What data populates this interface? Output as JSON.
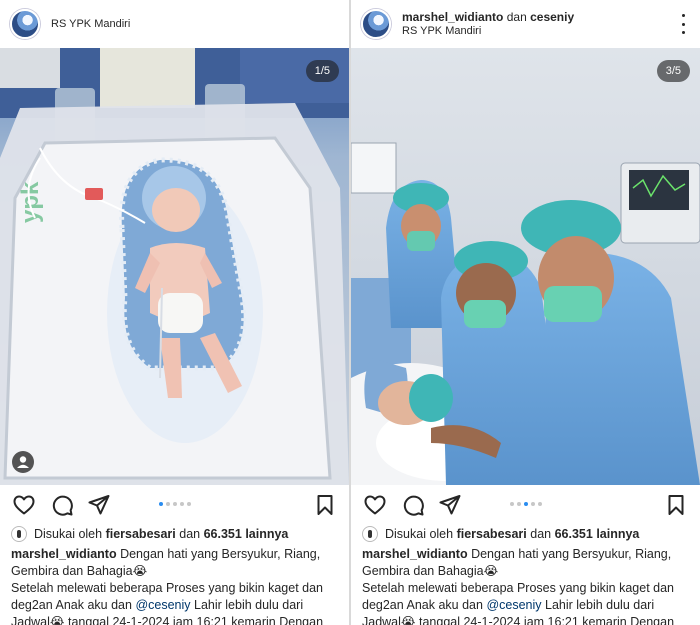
{
  "posts": [
    {
      "header": {
        "username": "",
        "conjunction": "",
        "collaborator": "",
        "location": "RS YPK Mandiri"
      },
      "counter": "1/5",
      "active_dot": 0,
      "likes": {
        "prefix": "Disukai oleh",
        "user": "fiersabesari",
        "middle": "dan",
        "count": "66.351",
        "suffix": "lainnya"
      },
      "caption": {
        "username": "marshel_widianto",
        "line1": "Dengan hati yang Bersyukur, Riang, Gembira dan Bahagia😭",
        "line2_pre": "Setelah melewati beberapa Proses yang bikin kaget dan deg2an Anak aku dan",
        "mention": "@ceseniy",
        "line2_post": "Lahir lebih dulu dari Jadwal😭 tanggal 24-1-2024 jam 16:21 kemarin Dengan"
      }
    },
    {
      "header": {
        "username": "marshel_widianto",
        "conjunction": "dan",
        "collaborator": "ceseniy",
        "location": "RS YPK Mandiri"
      },
      "counter": "3/5",
      "active_dot": 2,
      "likes": {
        "prefix": "Disukai oleh",
        "user": "fiersabesari",
        "middle": "dan",
        "count": "66.351",
        "suffix": "lainnya"
      },
      "caption": {
        "username": "marshel_widianto",
        "line1": "Dengan hati yang Bersyukur, Riang, Gembira dan Bahagia😭",
        "line2_pre": "Setelah melewati beberapa Proses yang bikin kaget dan deg2an Anak aku dan",
        "mention": "@ceseniy",
        "line2_post": "Lahir lebih dulu dari Jadwal😭 tanggal 24-1-2024 jam 16:21 kemarin Dengan"
      }
    }
  ],
  "icons": {
    "like": "heart-icon",
    "comment": "comment-icon",
    "share": "paper-plane-icon",
    "save": "bookmark-icon",
    "tag": "person-tag-icon",
    "more": "more-dots-icon"
  },
  "colors": {
    "text": "#262626",
    "mention": "#00376b",
    "active_dot": "#2a8df0",
    "inactive_dot": "#c7c7c7",
    "scrub_green": "#3fb6b6",
    "scrub_blue": "#6aa6de"
  }
}
